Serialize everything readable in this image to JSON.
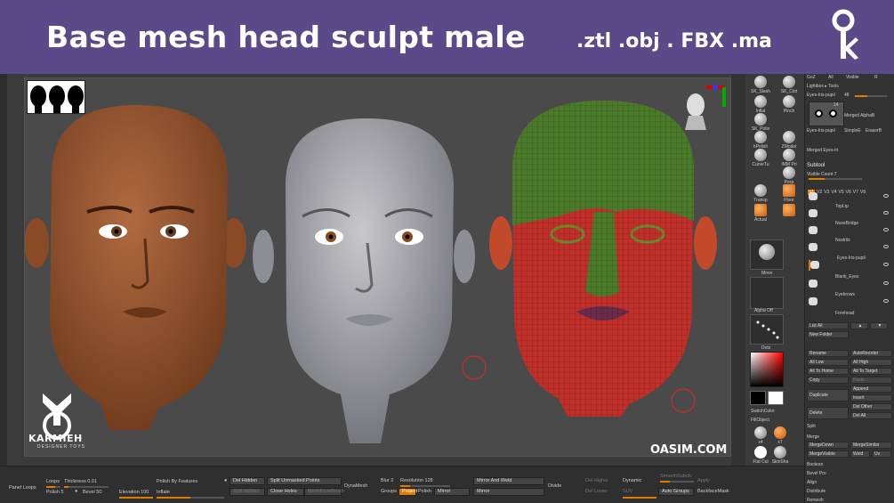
{
  "banner": {
    "title": "Base mesh head sculpt male",
    "formats": ".ztl .obj . FBX .ma",
    "logo_icon": "key-k-logo-icon",
    "background": "#5a4a8a"
  },
  "viewport": {
    "watermark_left_brand": "KARMIEH",
    "watermark_left_sub": "DESIGNER TOYS",
    "watermark_right": "OASIM.COM"
  },
  "tools": {
    "brushes": [
      {
        "label": "SK_Slash"
      },
      {
        "label": "SK_Clot"
      },
      {
        "label": "Inflat"
      },
      {
        "label": "Pinch"
      },
      {
        "label": "SK_Polis"
      },
      {
        "label": "hPolish"
      },
      {
        "label": "ZModel"
      },
      {
        "label": "CurveTu"
      },
      {
        "label": "IMM Pri"
      },
      {
        "label": "Perp"
      },
      {
        "label": "Transp"
      },
      {
        "label": "Floor"
      },
      {
        "label": "Actual"
      }
    ],
    "move_label": "Move",
    "alpha_label": "Alpha Off",
    "dots_label": "Dots",
    "switch_color": "SwitchColor",
    "fill_object": "FillObject",
    "flat_color": "Flat Col",
    "skin_shade": "SkinSha",
    "x4": "x4",
    "x7": "x7"
  },
  "subtool": {
    "top_rows": [
      "GoZ",
      "All",
      "Visible",
      "R"
    ],
    "lightbox_tools": "Lightbox ▸ Tools",
    "current_tool": "Eyes-Iris-pupil",
    "tool_count": "48",
    "thumbnails": [
      {
        "label": "Eyes-Iris-pupil"
      },
      {
        "label": "Merged Eyes-Iri"
      },
      {
        "label": "Merged AlphaB"
      },
      {
        "label": "SimpleE"
      },
      {
        "label": "EraserB"
      }
    ],
    "thumb_count": "14",
    "title": "Subtool",
    "visible_count": "Visible Count 7",
    "version_tabs": [
      "V1",
      "V2",
      "V3",
      "V4",
      "V5",
      "V6",
      "V7",
      "V8"
    ],
    "items": [
      {
        "name": "TopLip"
      },
      {
        "name": "NoseBridge"
      },
      {
        "name": "Nostrils"
      },
      {
        "name": "Eyes-Iris-pupil"
      },
      {
        "name": "Blank_Eyes"
      },
      {
        "name": "Eyebrows"
      },
      {
        "name": "Forehead"
      }
    ],
    "list_all": "List All",
    "new_folder": "New Folder",
    "buttons": [
      [
        "Rename",
        "AutoReorder"
      ],
      [
        "All Low",
        "All High"
      ],
      [
        "All To Home",
        "All To Target"
      ],
      [
        "Copy",
        "Paste"
      ],
      [
        "Duplicate",
        "Append"
      ],
      [
        "",
        "Insert"
      ],
      [
        "Delete",
        "Del Other"
      ],
      [
        "",
        "Del All"
      ]
    ],
    "split": "Split",
    "merge": "Merge",
    "merge_down": "MergeDown",
    "merge_similar": "MergeSimilar",
    "merge_visible": "MergeVisible",
    "weld": "Weld",
    "uv": "Uv",
    "boolean": "Boolean",
    "bevel_pro": "Bevel Pro",
    "align": "Align",
    "distribute": "Distribute",
    "remesh": "Remesh"
  },
  "bottom": {
    "panel_loops": "Panel Loops",
    "loops": "Loops",
    "thickness": "Thickness 0.01",
    "polish": "Polish 5",
    "bevel": "Bevel 50",
    "elevation": "Elevation 100",
    "polish_by_features": "Polish By Features",
    "inflate": "Inflate",
    "del_hidden": "Del Hidden",
    "split_hidden": "Split Hidden",
    "split_unmasked": "Split Unmasked Points",
    "close_holes": "Close Holes",
    "mesh_from_brush": "MeshFromBrush",
    "dynamesh": "DynaMesh",
    "blur": "Blur 2",
    "resolution": "Resolution 128",
    "groups": "Groups",
    "project": "Project",
    "polish2": "Polish",
    "mirror": "Mirror",
    "mirror_and_weld": "Mirror And Weld",
    "mirror2": "Mirror",
    "divide": "Divide",
    "del_higher": "Del Higher",
    "del_lower": "Del Lower",
    "dynamic": "Dynamic",
    "smooth_subdiv": "SmoothSubdiv",
    "suv": "SUV",
    "apply": "Apply",
    "auto_groups": "Auto Groups",
    "backface_mask": "BackfaceMask"
  }
}
